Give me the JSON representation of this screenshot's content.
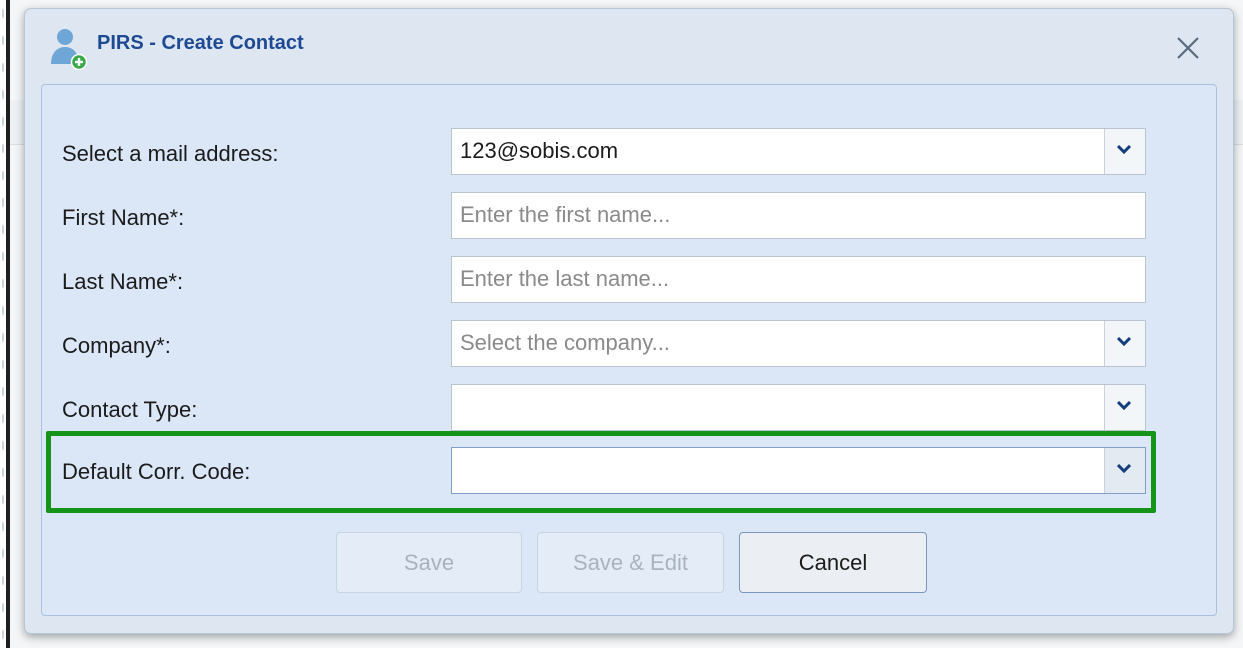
{
  "dialog": {
    "title": "PIRS - Create Contact",
    "icon": "add-contact-icon",
    "close_icon": "close-icon"
  },
  "form": {
    "mail_address": {
      "label": "Select a mail address:",
      "value": "123@sobis.com"
    },
    "first_name": {
      "label": "First Name*:",
      "placeholder": "Enter the first name..."
    },
    "last_name": {
      "label": "Last Name*:",
      "placeholder": "Enter the last name..."
    },
    "company": {
      "label": "Company*:",
      "placeholder": "Select the company..."
    },
    "contact_type": {
      "label": "Contact Type:",
      "value": ""
    },
    "default_corr_code": {
      "label": "Default Corr. Code:",
      "value": ""
    }
  },
  "buttons": {
    "save": "Save",
    "save_edit": "Save & Edit",
    "cancel": "Cancel"
  },
  "colors": {
    "title": "#1e4a94",
    "highlight": "#14951a",
    "dialog_bg": "#dde6f1"
  }
}
